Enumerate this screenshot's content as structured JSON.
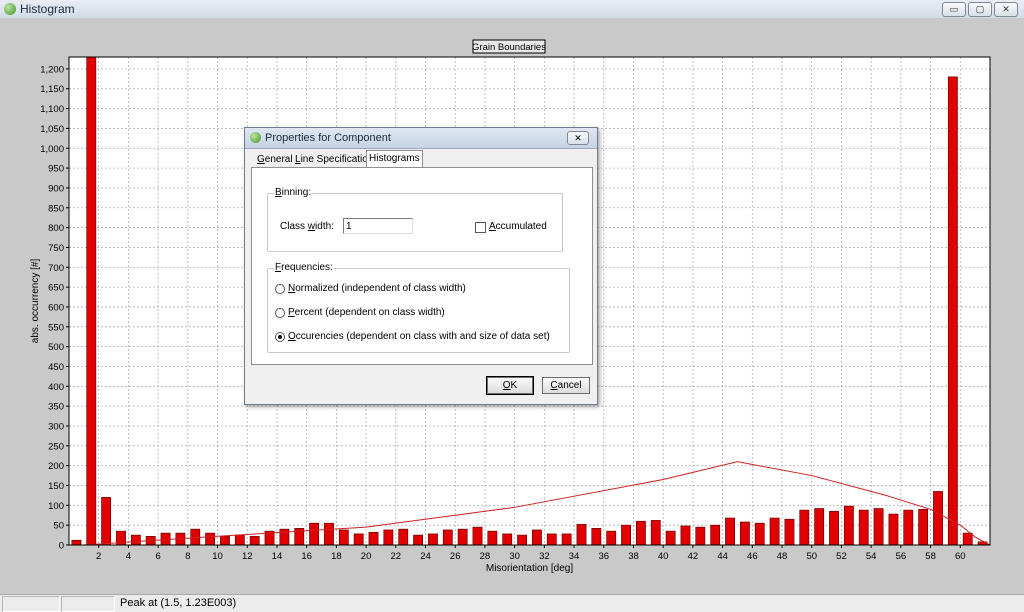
{
  "window": {
    "title": "Histogram",
    "controls": {
      "minimize": "▭",
      "maximize": "▢",
      "close": "✕"
    }
  },
  "status": {
    "peak_text": "Peak at (1.5, 1.23E003)"
  },
  "chart_data": {
    "type": "bar",
    "title": "Grain Boundaries",
    "xlabel": "Misorientation [deg]",
    "ylabel": "abs. occurrency [#]",
    "ylim": [
      0,
      1230
    ],
    "xlim": [
      0,
      62
    ],
    "yticks": [
      0,
      50,
      100,
      150,
      200,
      250,
      300,
      350,
      400,
      450,
      500,
      550,
      600,
      650,
      700,
      750,
      800,
      850,
      900,
      950,
      1000,
      1050,
      1100,
      1150,
      1200
    ],
    "ytick_labels": [
      "0",
      "50",
      "100",
      "150",
      "200",
      "250",
      "300",
      "350",
      "400",
      "450",
      "500",
      "550",
      "600",
      "650",
      "700",
      "750",
      "800",
      "850",
      "900",
      "950",
      "1,000",
      "1,050",
      "1,100",
      "1,150",
      "1,200"
    ],
    "xticks": [
      2,
      4,
      6,
      8,
      10,
      12,
      14,
      16,
      18,
      20,
      22,
      24,
      26,
      28,
      30,
      32,
      34,
      36,
      38,
      40,
      42,
      44,
      46,
      48,
      50,
      52,
      54,
      56,
      58,
      60
    ],
    "grid": true,
    "bar_color": "#e00000",
    "line_color": "#cc2222",
    "categories": [
      0.5,
      1.5,
      2.5,
      3.5,
      4.5,
      5.5,
      6.5,
      7.5,
      8.5,
      9.5,
      10.5,
      11.5,
      12.5,
      13.5,
      14.5,
      15.5,
      16.5,
      17.5,
      18.5,
      19.5,
      20.5,
      21.5,
      22.5,
      23.5,
      24.5,
      25.5,
      26.5,
      27.5,
      28.5,
      29.5,
      30.5,
      31.5,
      32.5,
      33.5,
      34.5,
      35.5,
      36.5,
      37.5,
      38.5,
      39.5,
      40.5,
      41.5,
      42.5,
      43.5,
      44.5,
      45.5,
      46.5,
      47.5,
      48.5,
      49.5,
      50.5,
      51.5,
      52.5,
      53.5,
      54.5,
      55.5,
      56.5,
      57.5,
      58.5,
      59.5,
      60.5,
      61.5
    ],
    "values": [
      12,
      1230,
      120,
      35,
      25,
      22,
      30,
      30,
      40,
      30,
      22,
      25,
      22,
      35,
      40,
      42,
      55,
      55,
      38,
      28,
      32,
      38,
      40,
      25,
      28,
      38,
      40,
      45,
      35,
      28,
      25,
      38,
      28,
      28,
      52,
      42,
      35,
      50,
      60,
      62,
      35,
      48,
      45,
      50,
      68,
      58,
      55,
      68,
      65,
      88,
      92,
      85,
      98,
      88,
      92,
      78,
      88,
      90,
      135,
      1180,
      30,
      8
    ],
    "line_x": [
      0,
      1,
      10,
      20,
      30,
      40,
      45,
      50,
      55,
      58,
      60,
      61,
      62
    ],
    "line_y": [
      0,
      0,
      22,
      45,
      95,
      165,
      210,
      175,
      125,
      90,
      50,
      20,
      0
    ]
  }
}
